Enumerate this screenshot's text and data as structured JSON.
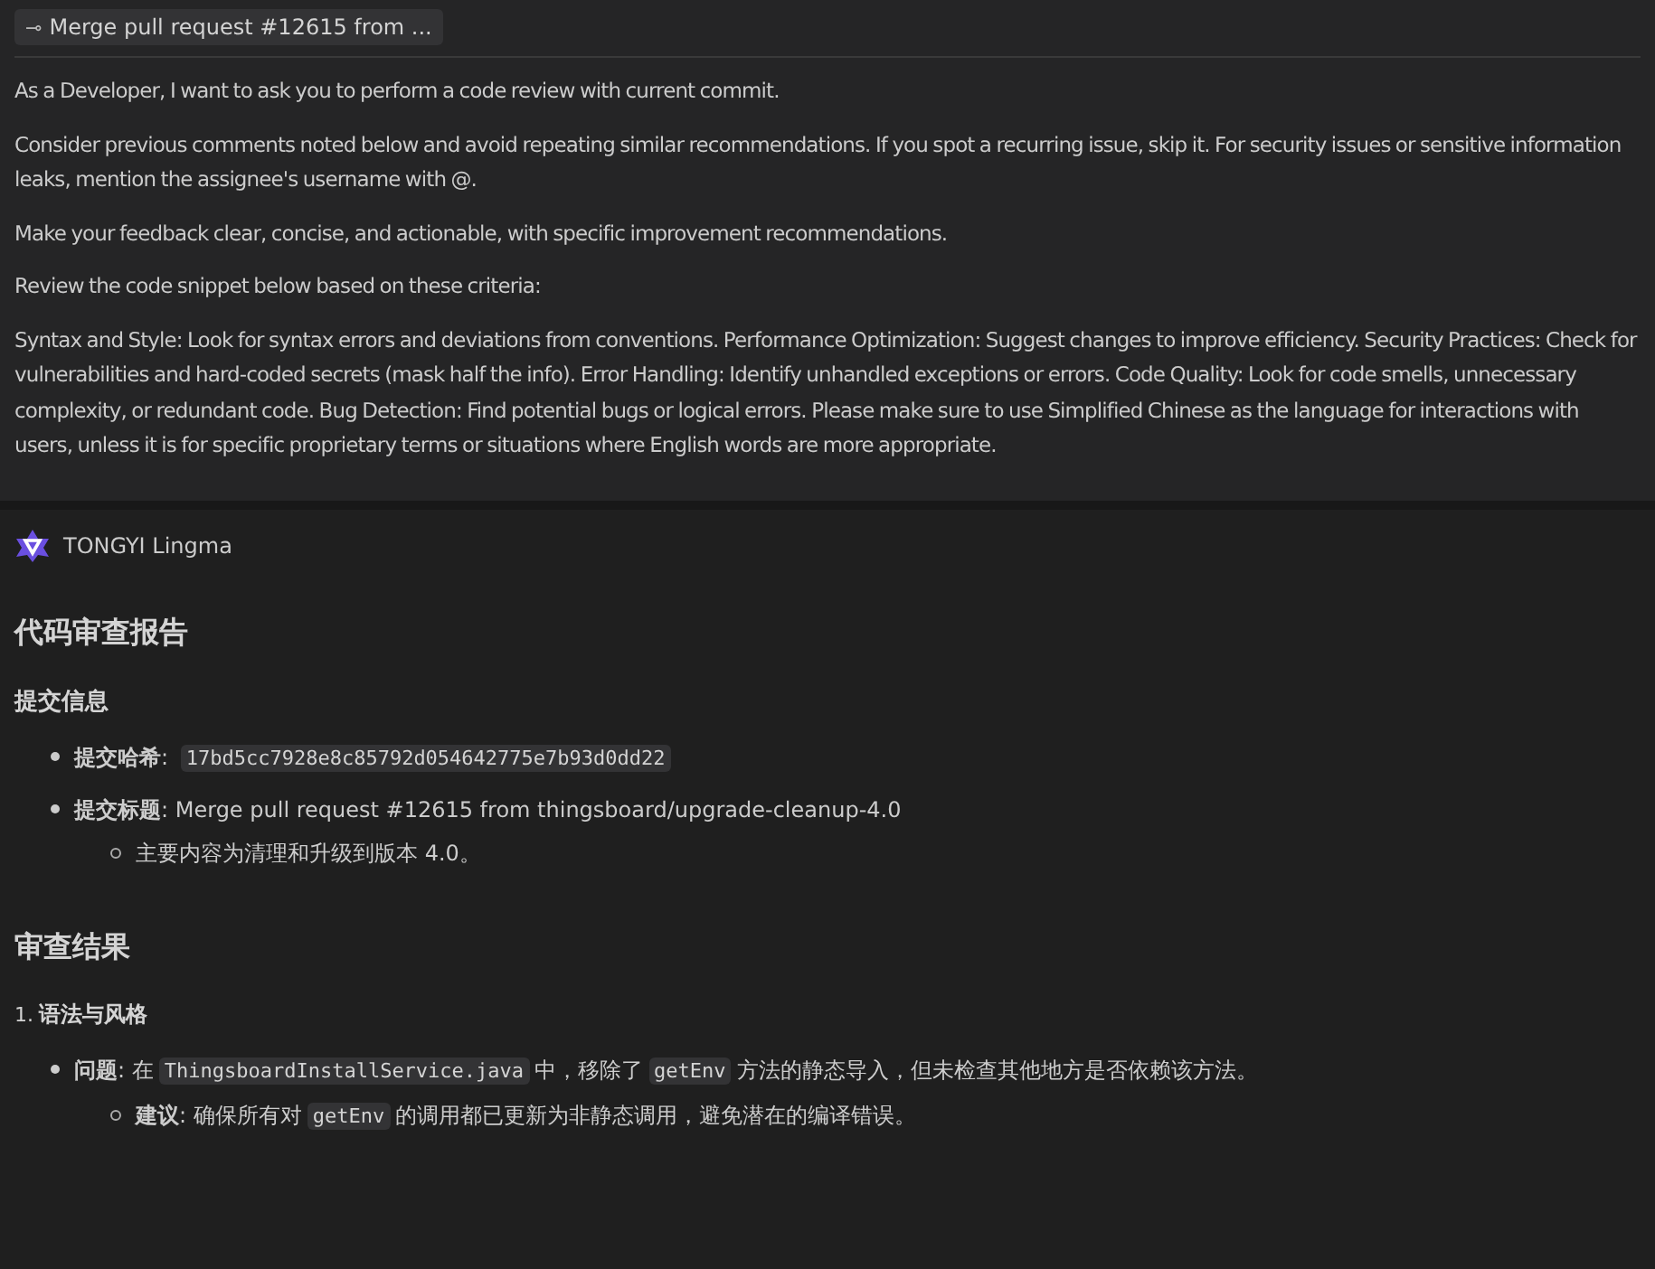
{
  "commit_chip": {
    "icon": "⊸",
    "label": "Merge pull request #12615 from ..."
  },
  "prompt": {
    "paragraphs": [
      "As a Developer, I want to ask you to perform a code review with current commit.",
      "Consider previous comments noted below and avoid repeating similar recommendations. If you spot a recurring issue, skip it. For security issues or sensitive information leaks, mention the assignee's username with @.",
      "Make your feedback clear, concise, and actionable, with specific improvement recommendations.",
      "Review the code snippet below based on these criteria:",
      "Syntax and Style: Look for syntax errors and deviations from conventions. Performance Optimization: Suggest changes to improve efficiency. Security Practices: Check for vulnerabilities and hard-coded secrets (mask half the info). Error Handling: Identify unhandled exceptions or errors. Code Quality: Look for code smells, unnecessary complexity, or redundant code. Bug Detection: Find potential bugs or logical errors. Please make sure to use Simplified Chinese as the language for interactions with users, unless it is for specific proprietary terms or situations where English words are more appropriate."
    ]
  },
  "response": {
    "author": "TONGYI Lingma",
    "blocks": [
      {
        "kind": "h2",
        "text": "代码审查报告"
      },
      {
        "kind": "h3",
        "text": "提交信息"
      },
      {
        "kind": "list",
        "items": [
          {
            "parts": [
              {
                "kind": "text",
                "text": "**提交哈希**: "
              },
              {
                "kind": "code",
                "text": "17bd5cc7928e8c85792d054642775e7b93d0dd22"
              }
            ]
          },
          {
            "parts": [
              {
                "kind": "text",
                "text": "**提交标题**: Merge pull request #12615 from thingsboard/upgrade-cleanup-4.0"
              }
            ],
            "children": [
              {
                "parts": [
                  {
                    "kind": "text",
                    "text": "主要内容为清理和升级到版本 4.0。"
                  }
                ]
              }
            ]
          }
        ]
      },
      {
        "kind": "h2",
        "text": "审查结果"
      },
      {
        "kind": "h4",
        "number": "1.",
        "text": "语法与风格"
      },
      {
        "kind": "list",
        "items": [
          {
            "parts": [
              {
                "kind": "text",
                "text": "**问题**: 在"
              },
              {
                "kind": "code",
                "text": "ThingsboardInstallService.java"
              },
              {
                "kind": "text",
                "text": "中，移除了"
              },
              {
                "kind": "code",
                "text": "getEnv"
              },
              {
                "kind": "text",
                "text": "方法的静态导入，但未检查其他地方是否依赖该方法。"
              }
            ],
            "children": [
              {
                "parts": [
                  {
                    "kind": "text",
                    "text": "**建议**: 确保所有对"
                  },
                  {
                    "kind": "code",
                    "text": "getEnv"
                  },
                  {
                    "kind": "text",
                    "text": "的调用都已更新为非静态调用，避免潜在的编译错误。"
                  }
                ]
              }
            ]
          }
        ]
      }
    ]
  }
}
